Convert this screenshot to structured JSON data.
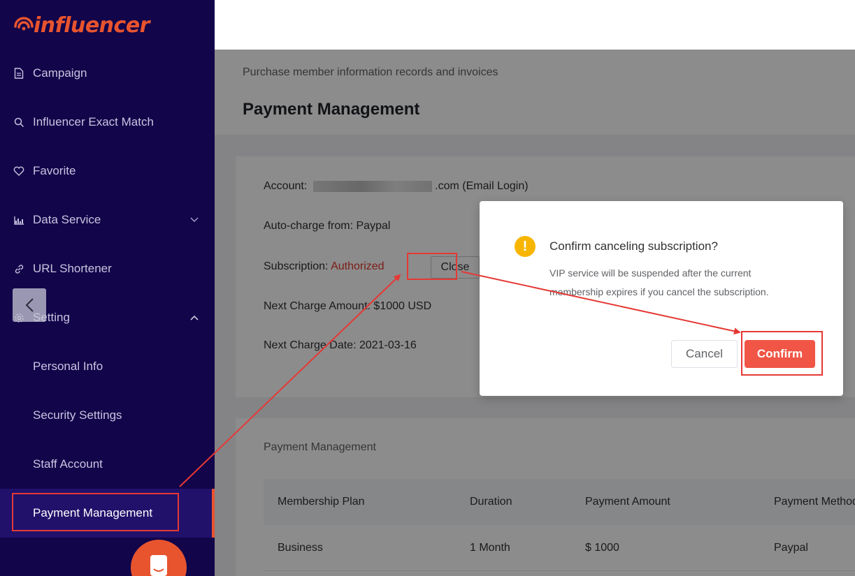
{
  "brand": {
    "logo_text": "influencer",
    "accent": "#e8542e",
    "sidebar_bg": "#12054a"
  },
  "sidebar": {
    "items": [
      {
        "label": "Campaign",
        "icon": "document-icon"
      },
      {
        "label": "Influencer Exact Match",
        "icon": "search-icon"
      },
      {
        "label": "Favorite",
        "icon": "heart-icon"
      },
      {
        "label": "Data Service",
        "icon": "chart-icon"
      },
      {
        "label": "URL Shortener",
        "icon": "link-icon"
      },
      {
        "label": "Setting",
        "icon": "gear-icon"
      }
    ],
    "sub_items": [
      {
        "label": "Personal Info"
      },
      {
        "label": "Security Settings"
      },
      {
        "label": "Staff Account"
      },
      {
        "label": "Payment Management"
      }
    ]
  },
  "page": {
    "breadcrumb": "Purchase member information records and invoices",
    "title": "Payment Management"
  },
  "account": {
    "account_label": "Account:",
    "email_suffix": ".com (Email Login)",
    "autocharge": "Auto-charge from: Paypal",
    "subscription_label": "Subscription:",
    "subscription_status": "Authorized",
    "close_button": "Close",
    "next_amount": "Next Charge Amount: $1000 USD",
    "next_date": "Next Charge Date: 2021-03-16"
  },
  "payments": {
    "title": "Payment Management",
    "columns": [
      "Membership Plan",
      "Duration",
      "Payment Amount",
      "Payment Method"
    ],
    "rows": [
      [
        "Business",
        "1 Month",
        "$ 1000",
        "Paypal"
      ]
    ]
  },
  "dialog": {
    "title": "Confirm canceling subscription?",
    "message": "VIP service will be suspended after the current membership expires if you cancel the subscription.",
    "cancel": "Cancel",
    "confirm": "Confirm",
    "confirm_color": "#f05545",
    "warning_color": "#f7b500"
  },
  "annotation_color": "#e53935"
}
